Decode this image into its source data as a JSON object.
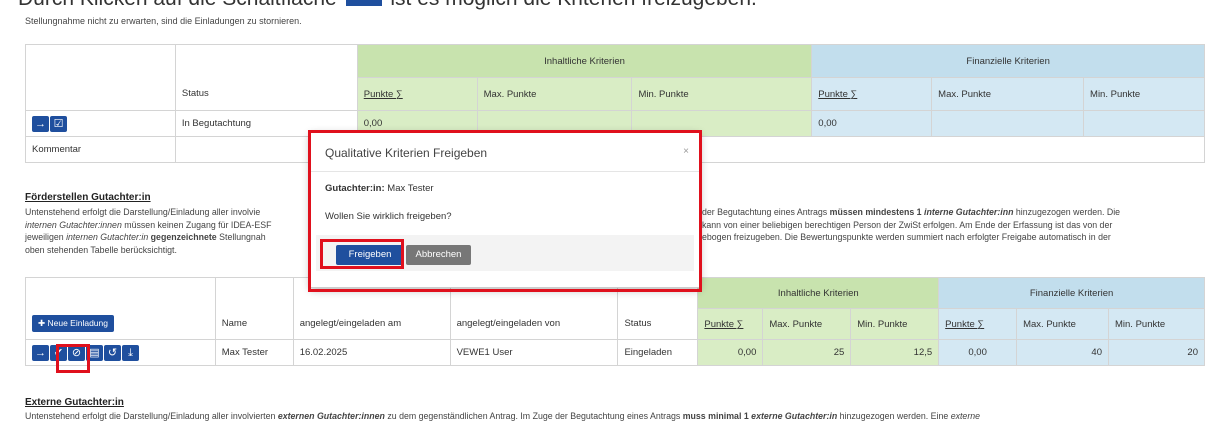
{
  "caption": {
    "part1": "Durch Klicken auf die Schaltfläche",
    "part2": "ist es möglich die Kriterien freizugeben."
  },
  "intro_text": "Stellungnahme nicht zu erwarten, sind die Einladungen zu stornieren.",
  "top_table": {
    "group_inhalt": "Inhaltliche Kriterien",
    "group_finanz": "Finanzielle Kriterien",
    "status_header": "Status",
    "col_punkte": "Punkte ∑",
    "col_max": "Max. Punkte",
    "col_min": "Min. Punkte",
    "row_status": "In Begutachtung",
    "row_punkte_inhalt": "0,00",
    "row_punkte_finanz": "0,00",
    "kommentar_label": "Kommentar"
  },
  "section_foerder": {
    "title": "Förderstellen Gutachter:in",
    "l1a": "Untenstehend erfolgt die Darstellung/Einladung aller involvie",
    "l1b": "der Begutachtung eines Antrags ",
    "l1c": "müssen mindestens 1 ",
    "l1d": "interne Gutachter:inn",
    "l1e": " hinzugezogen werden. Die",
    "l2a": "internen Gutachter:innen",
    "l2b": " müssen keinen Zugang für IDEA-ESF",
    "l2c": "kann von einer beliebigen berechtigen Person der ZwiSt erfolgen. Am Ende der Erfassung ist das von der",
    "l3a": "jeweiligen ",
    "l3b": "internen Gutachter:in",
    "l3c": " gegenzeichnete",
    "l3d": " Stellungnah",
    "l3e": "ebogen freizugeben. Die Bewertungspunkte werden summiert nach erfolgter Freigabe automatisch in der",
    "l4": "oben stehenden Tabelle berücksichtigt."
  },
  "bottom_table": {
    "new_invite": "Neue Einladung",
    "group_inhalt": "Inhaltliche Kriterien",
    "group_finanz": "Finanzielle Kriterien",
    "col_name": "Name",
    "col_datum": "angelegt/eingeladen am",
    "col_von": "angelegt/eingeladen von",
    "col_status": "Status",
    "col_punkte": "Punkte ∑",
    "col_max": "Max. Punkte",
    "col_min": "Min. Punkte",
    "row": {
      "name": "Max Tester",
      "datum": "16.02.2025",
      "von": "VEWE1 User",
      "status": "Eingeladen",
      "inhalt_punkte": "0,00",
      "inhalt_max": "25",
      "inhalt_min": "12,5",
      "finanz_punkte": "0,00",
      "finanz_max": "40",
      "finanz_min": "20"
    }
  },
  "section_extern": {
    "title": "Externe Gutachter:in",
    "t1": "Untenstehend erfolgt die Darstellung/Einladung aller involvierten ",
    "t2": "externen Gutachter:innen",
    "t3": " zu dem gegenständlichen Antrag. Im Zuge der Begutachtung eines Antrags ",
    "t4": "muss minimal 1 ",
    "t5": "externe Gutachter:in",
    "t6": " hinzugezogen werden. Eine ",
    "t7": "externe"
  },
  "modal": {
    "title": "Qualitative Kriterien Freigeben",
    "close": "×",
    "gutachter_label": "Gutachter:in:",
    "gutachter_name": "Max Tester",
    "question": "Wollen Sie wirklich freigeben?",
    "confirm": "Freigeben",
    "cancel": "Abbrechen"
  },
  "colors": {
    "primary": "#1f4f9e",
    "highlight_red": "#e0101d",
    "green": "#d9edc5",
    "blue": "#d4e8f3"
  }
}
